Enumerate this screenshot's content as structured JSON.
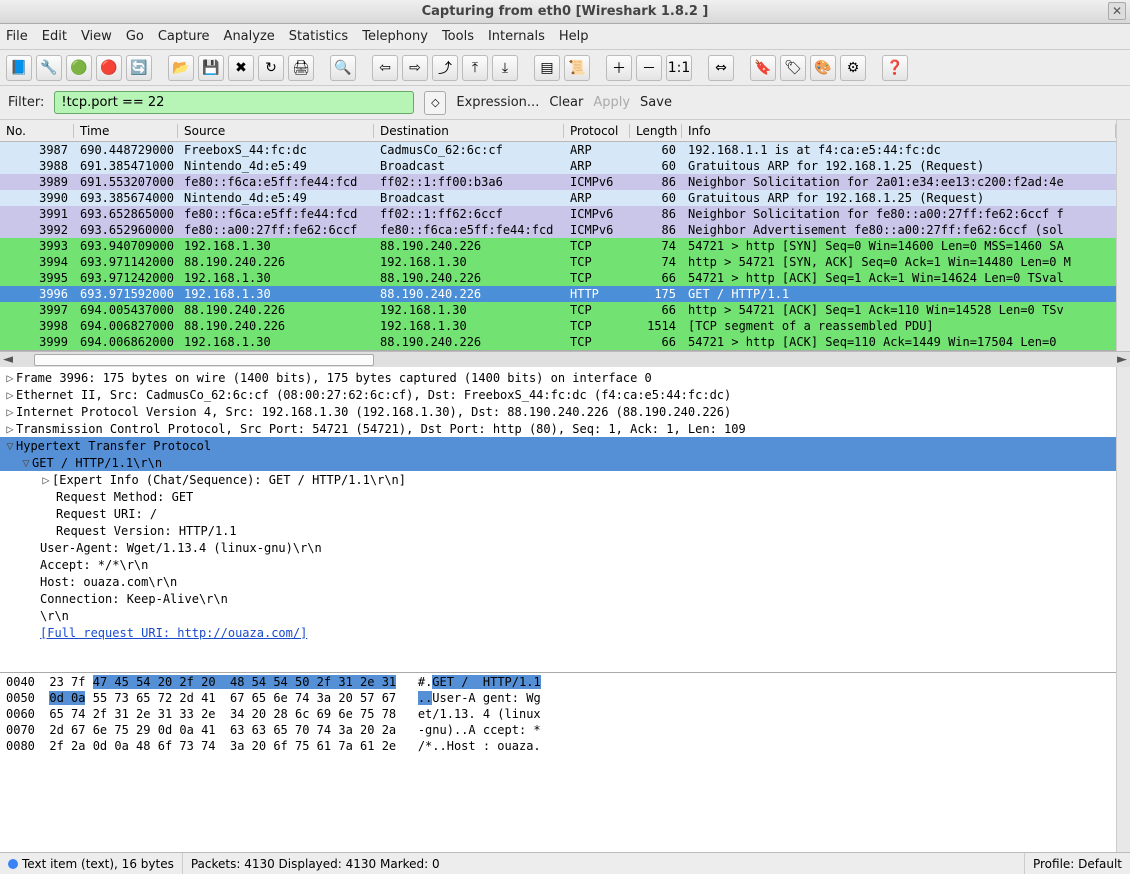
{
  "window": {
    "title": "Capturing from eth0    [Wireshark 1.8.2 ]"
  },
  "menu": [
    "File",
    "Edit",
    "View",
    "Go",
    "Capture",
    "Analyze",
    "Statistics",
    "Telephony",
    "Tools",
    "Internals",
    "Help"
  ],
  "filter": {
    "label": "Filter:",
    "value": "!tcp.port == 22",
    "expression": "Expression...",
    "clear": "Clear",
    "apply": "Apply",
    "save": "Save"
  },
  "columns": {
    "no": "No.",
    "time": "Time",
    "source": "Source",
    "destination": "Destination",
    "protocol": "Protocol",
    "length": "Length",
    "info": "Info"
  },
  "packets": [
    {
      "no": "3987",
      "time": "690.448729000",
      "src": "FreeboxS_44:fc:dc",
      "dst": "CadmusCo_62:6c:cf",
      "proto": "ARP",
      "len": "60",
      "info": "192.168.1.1 is at f4:ca:e5:44:fc:dc",
      "bg": "#d6e8f7"
    },
    {
      "no": "3988",
      "time": "691.385471000",
      "src": "Nintendo_4d:e5:49",
      "dst": "Broadcast",
      "proto": "ARP",
      "len": "60",
      "info": "Gratuitous ARP for 192.168.1.25 (Request)",
      "bg": "#d6e8f7"
    },
    {
      "no": "3989",
      "time": "691.553207000",
      "src": "fe80::f6ca:e5ff:fe44:fcd",
      "dst": "ff02::1:ff00:b3a6",
      "proto": "ICMPv6",
      "len": "86",
      "info": "Neighbor Solicitation for 2a01:e34:ee13:c200:f2ad:4e",
      "bg": "#c9c6ea"
    },
    {
      "no": "3990",
      "time": "693.385674000",
      "src": "Nintendo_4d:e5:49",
      "dst": "Broadcast",
      "proto": "ARP",
      "len": "60",
      "info": "Gratuitous ARP for 192.168.1.25 (Request)",
      "bg": "#d6e8f7"
    },
    {
      "no": "3991",
      "time": "693.652865000",
      "src": "fe80::f6ca:e5ff:fe44:fcd",
      "dst": "ff02::1:ff62:6ccf",
      "proto": "ICMPv6",
      "len": "86",
      "info": "Neighbor Solicitation for fe80::a00:27ff:fe62:6ccf f",
      "bg": "#c9c6ea"
    },
    {
      "no": "3992",
      "time": "693.652960000",
      "src": "fe80::a00:27ff:fe62:6ccf",
      "dst": "fe80::f6ca:e5ff:fe44:fcd",
      "proto": "ICMPv6",
      "len": "86",
      "info": "Neighbor Advertisement fe80::a00:27ff:fe62:6ccf (sol",
      "bg": "#c9c6ea"
    },
    {
      "no": "3993",
      "time": "693.940709000",
      "src": "192.168.1.30",
      "dst": "88.190.240.226",
      "proto": "TCP",
      "len": "74",
      "info": "54721 > http [SYN] Seq=0 Win=14600 Len=0 MSS=1460 SA",
      "bg": "#72e372"
    },
    {
      "no": "3994",
      "time": "693.971142000",
      "src": "88.190.240.226",
      "dst": "192.168.1.30",
      "proto": "TCP",
      "len": "74",
      "info": "http > 54721 [SYN, ACK] Seq=0 Ack=1 Win=14480 Len=0 M",
      "bg": "#72e372"
    },
    {
      "no": "3995",
      "time": "693.971242000",
      "src": "192.168.1.30",
      "dst": "88.190.240.226",
      "proto": "TCP",
      "len": "66",
      "info": "54721 > http [ACK] Seq=1 Ack=1 Win=14624 Len=0 TSval",
      "bg": "#72e372"
    },
    {
      "no": "3996",
      "time": "693.971592000",
      "src": "192.168.1.30",
      "dst": "88.190.240.226",
      "proto": "HTTP",
      "len": "175",
      "info": "GET / HTTP/1.1",
      "bg": "#4b8fd8",
      "sel": true
    },
    {
      "no": "3997",
      "time": "694.005437000",
      "src": "88.190.240.226",
      "dst": "192.168.1.30",
      "proto": "TCP",
      "len": "66",
      "info": "http > 54721 [ACK] Seq=1 Ack=110 Win=14528 Len=0 TSv",
      "bg": "#72e372"
    },
    {
      "no": "3998",
      "time": "694.006827000",
      "src": "88.190.240.226",
      "dst": "192.168.1.30",
      "proto": "TCP",
      "len": "1514",
      "info": "[TCP segment of a reassembled PDU]",
      "bg": "#72e372"
    },
    {
      "no": "3999",
      "time": "694.006862000",
      "src": "192.168.1.30",
      "dst": "88.190.240.226",
      "proto": "TCP",
      "len": "66",
      "info": "54721 > http [ACK] Seq=110 Ack=1449 Win=17504 Len=0",
      "bg": "#72e372"
    }
  ],
  "details": {
    "frame": "Frame 3996: 175 bytes on wire (1400 bits), 175 bytes captured (1400 bits) on interface 0",
    "eth": "Ethernet II, Src: CadmusCo_62:6c:cf (08:00:27:62:6c:cf), Dst: FreeboxS_44:fc:dc (f4:ca:e5:44:fc:dc)",
    "ip": "Internet Protocol Version 4, Src: 192.168.1.30 (192.168.1.30), Dst: 88.190.240.226 (88.190.240.226)",
    "tcp": "Transmission Control Protocol, Src Port: 54721 (54721), Dst Port: http (80), Seq: 1, Ack: 1, Len: 109",
    "http": "Hypertext Transfer Protocol",
    "getline": "GET / HTTP/1.1\\r\\n",
    "expert": "[Expert Info (Chat/Sequence): GET / HTTP/1.1\\r\\n]",
    "method": "Request Method: GET",
    "uri": "Request URI: /",
    "version": "Request Version: HTTP/1.1",
    "ua": "User-Agent: Wget/1.13.4 (linux-gnu)\\r\\n",
    "accept": "Accept: */*\\r\\n",
    "host": "Host: ouaza.com\\r\\n",
    "conn": "Connection: Keep-Alive\\r\\n",
    "crlf": "\\r\\n",
    "fulluri": "[Full request URI: http://ouaza.com/]"
  },
  "hex": {
    "l1": {
      "off": "0040",
      "b1": "23 7f",
      "b2": "47 45 54 20 2f 20  48 54 54 50 2f 31 2e 31",
      "a1": "#.",
      "a2": "GET /  HTTP/1.1"
    },
    "l2": {
      "off": "0050",
      "b1": "0d 0a",
      "b2": "55 73 65 72 2d 41  67 65 6e 74 3a 20 57 67",
      "a1": "..",
      "a2": "User-A gent: Wg"
    },
    "l3": {
      "off": "0060",
      "b": "65 74 2f 31 2e 31 33 2e  34 20 28 6c 69 6e 75 78",
      "a": "et/1.13. 4 (linux"
    },
    "l4": {
      "off": "0070",
      "b": "2d 67 6e 75 29 0d 0a 41  63 63 65 70 74 3a 20 2a",
      "a": "-gnu)..A ccept: *"
    },
    "l5": {
      "off": "0080",
      "b": "2f 2a 0d 0a 48 6f 73 74  3a 20 6f 75 61 7a 61 2e",
      "a": "/*..Host : ouaza."
    }
  },
  "status": {
    "left": "Text item (text), 16 bytes",
    "mid": "Packets: 4130 Displayed: 4130 Marked: 0",
    "right": "Profile: Default"
  }
}
